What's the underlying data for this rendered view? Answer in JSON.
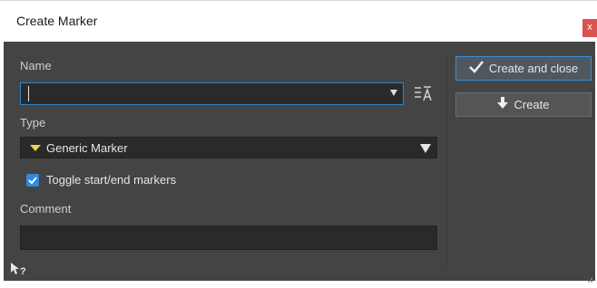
{
  "window": {
    "title": "Create Marker",
    "close_label": "x"
  },
  "form": {
    "name_label": "Name",
    "name_value": "",
    "type_label": "Type",
    "type_value": "Generic Marker",
    "toggle_label": "Toggle start/end markers",
    "toggle_checked": true,
    "comment_label": "Comment",
    "comment_value": ""
  },
  "buttons": {
    "create_and_close": "Create and close",
    "create": "Create"
  },
  "colors": {
    "accent": "#2c84c7",
    "marker_yellow": "#e6d44a",
    "close_red": "#d9534f",
    "panel_bg": "#444444"
  },
  "icons": {
    "sort": "sort-alpha-icon",
    "help": "help-pointer-icon",
    "check": "checkmark-icon",
    "arrow_down": "arrow-down-icon",
    "marker": "marker-triangle-icon"
  }
}
